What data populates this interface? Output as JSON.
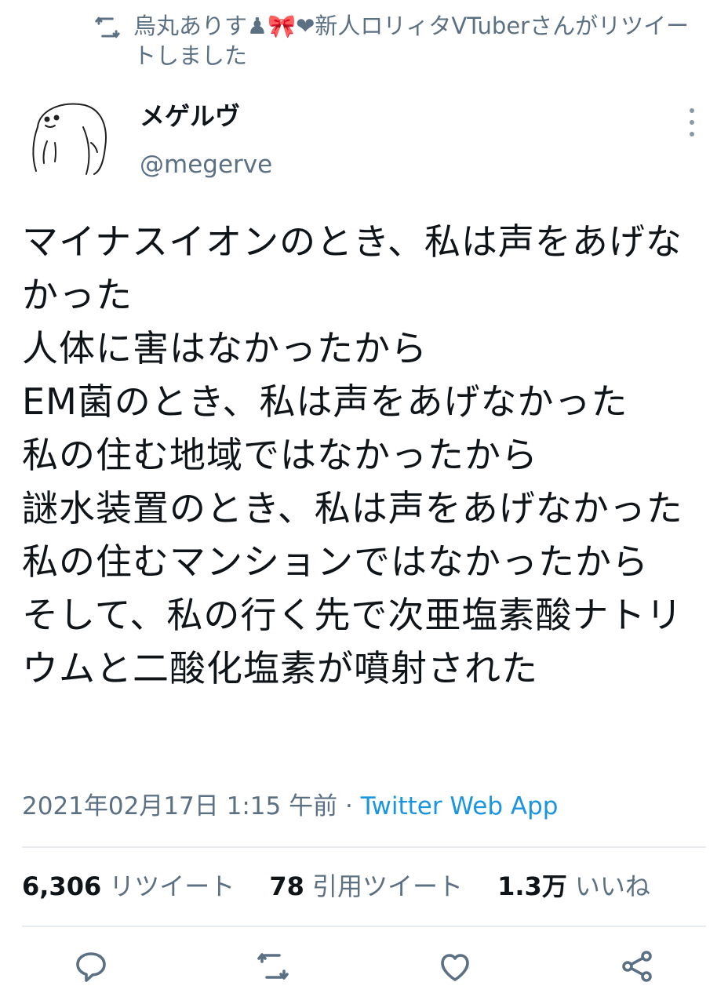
{
  "retweet_context": {
    "text": "烏丸ありす♟🎀❤新人ロリィタVTuberさんがリツイートしました",
    "icon": "retweet-icon"
  },
  "author": {
    "display_name": "メゲルヴ",
    "handle": "@megerve",
    "avatar": "sketch-avatar"
  },
  "tweet": {
    "text": "マイナスイオンのとき、私は声をあげなかった\n人体に害はなかったから\nEM菌のとき、私は声をあげなかった\n私の住む地域ではなかったから\n謎水装置のとき、私は声をあげなかった\n私の住むマンションではなかったから\nそして、私の行く先で次亜塩素酸ナトリウムと二酸化塩素が噴射された"
  },
  "meta": {
    "timestamp": "2021年02月17日 1:15 午前",
    "separator": " · ",
    "source": "Twitter Web App"
  },
  "stats": {
    "retweets_count": "6,306",
    "retweets_label": "リツイート",
    "quotes_count": "78",
    "quotes_label": "引用ツイート",
    "likes_count": "1.3万",
    "likes_label": "いいね"
  },
  "actions": [
    "reply-icon",
    "retweet-icon",
    "like-icon",
    "share-icon"
  ],
  "colors": {
    "text": "#0f1419",
    "secondary": "#5b7083",
    "link": "#1b95e0",
    "divider": "#e6ecf0"
  }
}
